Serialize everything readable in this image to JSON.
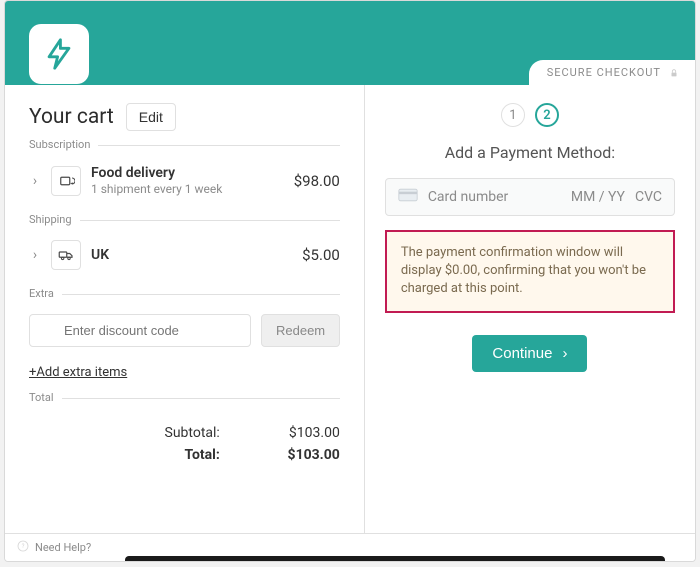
{
  "header": {
    "secure_label": "SECURE CHECKOUT"
  },
  "cart": {
    "title": "Your cart",
    "edit_label": "Edit",
    "sections": {
      "subscription_label": "Subscription",
      "shipping_label": "Shipping",
      "extra_label": "Extra",
      "total_label": "Total"
    },
    "subscription": {
      "title": "Food delivery",
      "subtitle": "1 shipment every 1 week",
      "price": "$98.00"
    },
    "shipping": {
      "title": "UK",
      "price": "$5.00"
    },
    "discount": {
      "placeholder": "Enter discount code",
      "redeem_label": "Redeem"
    },
    "add_extra_label": "+Add extra items",
    "totals": {
      "subtotal_label": "Subtotal:",
      "subtotal_value": "$103.00",
      "total_label": "Total:",
      "total_value": "$103.00"
    }
  },
  "payment": {
    "step1": "1",
    "step2": "2",
    "title": "Add a Payment Method:",
    "card_number_placeholder": "Card number",
    "expiry_placeholder": "MM / YY",
    "cvc_placeholder": "CVC",
    "notice": "The payment confirmation window will display $0.00, confirming that you won't be charged at this point.",
    "continue_label": "Continue"
  },
  "footer": {
    "help_label": "Need Help?"
  }
}
